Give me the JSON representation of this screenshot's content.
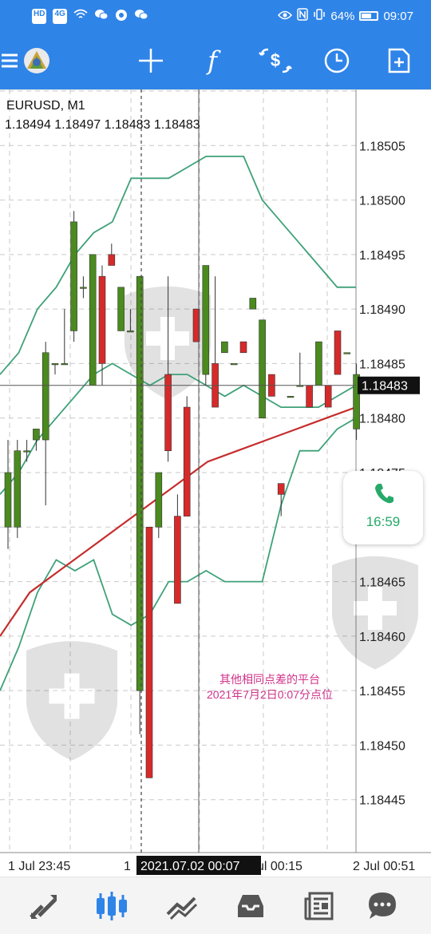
{
  "status_bar": {
    "left_icons": [
      "hd-icon",
      "4g-signal-icon",
      "wifi-icon",
      "wechat-icon",
      "app-icon",
      "wechat-icon"
    ],
    "chip_hd": "HD",
    "chip_4g": "4G",
    "battery_text": "64%",
    "battery_level": 0.64,
    "time": "09:07"
  },
  "toolbar": {
    "icons": [
      "menu-icon",
      "app-logo-icon",
      "crosshair-icon",
      "function-icon",
      "trade-dollar-icon",
      "clock-icon",
      "add-chart-icon"
    ],
    "function_glyph": "f"
  },
  "chart_header": {
    "symbol": "EURUSD, M1",
    "ohlc": "1.18494 1.18497 1.18483 1.18483"
  },
  "annotation": {
    "line1": "其他相同点差的平台",
    "line2": "2021年7月2日0:07分点位"
  },
  "timer_bubble": {
    "time": "16:59",
    "icon": "phone-icon"
  },
  "bottom_nav": {
    "items": [
      "quotes-icon",
      "chart-icon",
      "trade-icon",
      "history-icon",
      "news-icon",
      "messages-icon"
    ],
    "active_item": "chart-icon"
  },
  "colors": {
    "brand": "#2f84e8",
    "bull": "#4a8a1e",
    "bear": "#d62a2a",
    "bands": "#3fa178",
    "moving_average": "#c62d2d",
    "annotation": "#d0338a",
    "timer": "#27a96a"
  },
  "chart_data": {
    "type": "candlestick",
    "symbol": "EURUSD",
    "timeframe": "M1",
    "ylim": [
      1.1844,
      1.1851
    ],
    "y_ticks": [
      "1.18505",
      "1.18500",
      "1.18495",
      "1.18490",
      "1.18485",
      "1.18480",
      "1.18475",
      "1.18470",
      "1.18465",
      "1.18460",
      "1.18455",
      "1.18450",
      "1.18445"
    ],
    "x_tick_labels": [
      "1 Jul 23:45",
      "1",
      "Jul 00:15",
      "2 Jul 00:51"
    ],
    "crosshair": {
      "price": "1.18483",
      "time": "2021.07.02 00:07"
    },
    "series_style": {
      "bull_color": "#4a8a1e",
      "bear_color": "#d62a2a"
    },
    "candles": [
      {
        "o": 1.1847,
        "h": 1.18478,
        "l": 1.18468,
        "c": 1.18475
      },
      {
        "o": 1.1847,
        "h": 1.18478,
        "l": 1.18469,
        "c": 1.18477
      },
      {
        "o": 1.18477,
        "h": 1.18478,
        "l": 1.18476,
        "c": 1.18477
      },
      {
        "o": 1.18478,
        "h": 1.18479,
        "l": 1.18477,
        "c": 1.18479
      },
      {
        "o": 1.18478,
        "h": 1.18487,
        "l": 1.18472,
        "c": 1.18486
      },
      {
        "o": 1.18485,
        "h": 1.18485,
        "l": 1.18484,
        "c": 1.18485
      },
      {
        "o": 1.18485,
        "h": 1.1849,
        "l": 1.18485,
        "c": 1.18485
      },
      {
        "o": 1.18488,
        "h": 1.18499,
        "l": 1.18487,
        "c": 1.18498
      },
      {
        "o": 1.18492,
        "h": 1.18493,
        "l": 1.18491,
        "c": 1.18492
      },
      {
        "o": 1.18483,
        "h": 1.18495,
        "l": 1.18483,
        "c": 1.18495
      },
      {
        "o": 1.18493,
        "h": 1.18494,
        "l": 1.18483,
        "c": 1.18485
      },
      {
        "o": 1.18495,
        "h": 1.18496,
        "l": 1.18494,
        "c": 1.18494
      },
      {
        "o": 1.18488,
        "h": 1.18492,
        "l": 1.18488,
        "c": 1.18492
      },
      {
        "o": 1.18488,
        "h": 1.1849,
        "l": 1.18488,
        "c": 1.18488
      },
      {
        "o": 1.18455,
        "h": 1.18493,
        "l": 1.18451,
        "c": 1.18493
      },
      {
        "o": 1.1847,
        "h": 1.1847,
        "l": 1.18447,
        "c": 1.18447
      },
      {
        "o": 1.1847,
        "h": 1.18475,
        "l": 1.18469,
        "c": 1.18475
      },
      {
        "o": 1.18484,
        "h": 1.18493,
        "l": 1.18476,
        "c": 1.18477
      },
      {
        "o": 1.18471,
        "h": 1.18473,
        "l": 1.18463,
        "c": 1.18463
      },
      {
        "o": 1.18481,
        "h": 1.18482,
        "l": 1.18471,
        "c": 1.18471
      },
      {
        "o": 1.1849,
        "h": 1.1849,
        "l": 1.18487,
        "c": 1.18487
      },
      {
        "o": 1.18484,
        "h": 1.18494,
        "l": 1.18483,
        "c": 1.18494
      },
      {
        "o": 1.18485,
        "h": 1.18493,
        "l": 1.18481,
        "c": 1.18481
      },
      {
        "o": 1.18486,
        "h": 1.18487,
        "l": 1.18486,
        "c": 1.18487
      },
      {
        "o": 1.18485,
        "h": 1.18485,
        "l": 1.18485,
        "c": 1.18485
      },
      {
        "o": 1.18487,
        "h": 1.18487,
        "l": 1.18486,
        "c": 1.18486
      },
      {
        "o": 1.1849,
        "h": 1.18491,
        "l": 1.1849,
        "c": 1.18491
      },
      {
        "o": 1.1848,
        "h": 1.18489,
        "l": 1.1848,
        "c": 1.18489
      },
      {
        "o": 1.18484,
        "h": 1.18484,
        "l": 1.18482,
        "c": 1.18482
      },
      {
        "o": 1.18474,
        "h": 1.18474,
        "l": 1.18471,
        "c": 1.18473
      },
      {
        "o": 1.18482,
        "h": 1.18482,
        "l": 1.18482,
        "c": 1.18482
      },
      {
        "o": 1.18483,
        "h": 1.18486,
        "l": 1.18483,
        "c": 1.18483
      },
      {
        "o": 1.18483,
        "h": 1.18483,
        "l": 1.18481,
        "c": 1.18481
      },
      {
        "o": 1.18483,
        "h": 1.18487,
        "l": 1.18483,
        "c": 1.18487
      },
      {
        "o": 1.18483,
        "h": 1.18483,
        "l": 1.18481,
        "c": 1.18481
      },
      {
        "o": 1.18488,
        "h": 1.18488,
        "l": 1.18484,
        "c": 1.18484
      },
      {
        "o": 1.18486,
        "h": 1.18486,
        "l": 1.18486,
        "c": 1.18486
      },
      {
        "o": 1.18479,
        "h": 1.18485,
        "l": 1.18478,
        "c": 1.18484
      }
    ],
    "bollinger": {
      "upper": [
        1.18484,
        1.18486,
        1.1849,
        1.18492,
        1.18495,
        1.18497,
        1.18498,
        1.18502,
        1.18502,
        1.18502,
        1.18503,
        1.18504,
        1.18504,
        1.18504,
        1.185,
        1.18498,
        1.18496,
        1.18494,
        1.18492,
        1.18492
      ],
      "middle": [
        1.18473,
        1.18475,
        1.18478,
        1.1848,
        1.18482,
        1.18484,
        1.18485,
        1.18484,
        1.18483,
        1.18484,
        1.18484,
        1.18483,
        1.18482,
        1.18483,
        1.18482,
        1.18481,
        1.18481,
        1.18481,
        1.18482,
        1.18483
      ],
      "lower": [
        1.18455,
        1.18459,
        1.18464,
        1.18467,
        1.18466,
        1.18467,
        1.18462,
        1.18461,
        1.18462,
        1.18465,
        1.18465,
        1.18466,
        1.18465,
        1.18465,
        1.18465,
        1.18472,
        1.18477,
        1.18477,
        1.18479,
        1.1848
      ]
    },
    "moving_average": [
      1.1846,
      1.18464,
      1.18466,
      1.18468,
      1.1847,
      1.18472,
      1.18474,
      1.18476,
      1.18477,
      1.18478,
      1.18479,
      1.1848,
      1.18481
    ]
  }
}
